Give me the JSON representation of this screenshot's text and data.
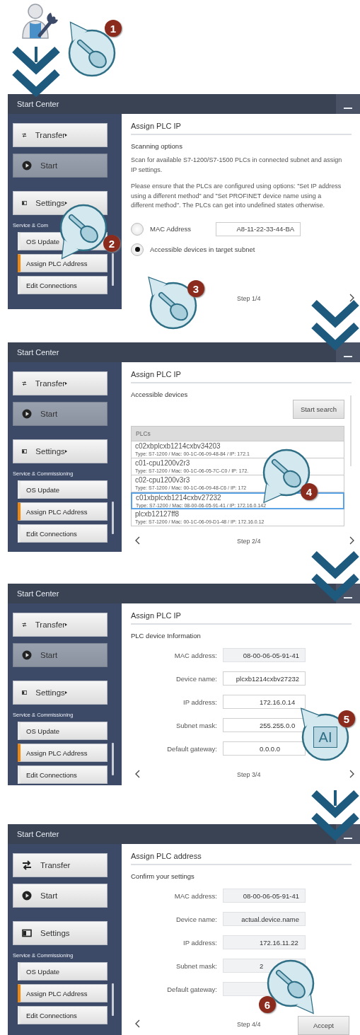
{
  "intro": {
    "callout": {
      "step": "1"
    }
  },
  "screens": [
    {
      "window_title": "Start Center",
      "sidebar": {
        "buttons": [
          {
            "label": "Transfer",
            "submenu": true,
            "disabled": false
          },
          {
            "label": "Start",
            "submenu": false,
            "disabled": true
          },
          {
            "label": "Settings",
            "submenu": true,
            "disabled": false
          }
        ],
        "section": "Service & Com",
        "items": [
          {
            "label": "OS Update",
            "selected": false
          },
          {
            "label": "Assign PLC Address",
            "selected": true
          },
          {
            "label": "Edit Connections",
            "selected": false
          }
        ]
      },
      "content": {
        "kind": "scan",
        "title": "Assign PLC IP",
        "subtitle": "Scanning options",
        "paragraphs": [
          "Scan for available S7-1200/S7-1500 PLCs in connected subnet and assign IP settings.",
          "Please ensure that the PLCs are configured using options: \"Set IP address using a different method\" and \"Set PROFINET device name using a different method\". The PLCs can get into undefined states otherwise."
        ],
        "options": [
          {
            "label": "MAC Address",
            "selected": false,
            "value": "A8-11-22-33-44-BA"
          },
          {
            "label": "Accessible devices in target subnet",
            "selected": true
          }
        ]
      },
      "footer": {
        "back": false,
        "step": "Step 1/4",
        "next": true
      },
      "callouts": [
        {
          "step": "2"
        },
        {
          "step": "3"
        }
      ]
    },
    {
      "window_title": "Start Center",
      "sidebar": {
        "buttons": [
          {
            "label": "Transfer",
            "submenu": true,
            "disabled": false
          },
          {
            "label": "Start",
            "submenu": false,
            "disabled": true
          },
          {
            "label": "Settings",
            "submenu": true,
            "disabled": false
          }
        ],
        "section": "Service & Commissioning",
        "items": [
          {
            "label": "OS Update",
            "selected": false
          },
          {
            "label": "Assign PLC Address",
            "selected": true
          },
          {
            "label": "Edit Connections",
            "selected": false
          }
        ]
      },
      "content": {
        "kind": "list",
        "title": "Assign PLC IP",
        "subtitle": "Accessible devices",
        "search_button": "Start search",
        "table_header": "PLCs",
        "rows": [
          {
            "name": "c02xbplcxb1214cxbv34203",
            "detail": "Type: S7-1200 / Mac: 00-1C-06-09-48-84 / IP: 172.1",
            "selected": false
          },
          {
            "name": "c01-cpu1200v2r3",
            "detail": "Type: S7-1200 / Mac: 00-1C-06-05-7C-C0 / IP: 172.",
            "selected": false
          },
          {
            "name": "c02-cpu1200v3r3",
            "detail": "Type: S7-1200 / Mac: 00-1C-06-09-48-C6 / IP: 172",
            "selected": false
          },
          {
            "name": "c01xbplcxb1214cxbv27232",
            "detail": "Type: S7-1200 / Mac: 08-00-06-05-91-41 / IP: 172.16.0.142",
            "selected": true
          },
          {
            "name": "plcxb12127ff8",
            "detail": "Type: S7-1200 / Mac: 00-1C-06-09-D1-48 / IP: 172.16.0.12",
            "selected": false
          }
        ]
      },
      "footer": {
        "back": true,
        "step": "Step 2/4",
        "next": true
      },
      "callouts": [
        {
          "step": "4"
        }
      ]
    },
    {
      "window_title": "Start Center",
      "sidebar": {
        "buttons": [
          {
            "label": "Transfer",
            "submenu": true,
            "disabled": false
          },
          {
            "label": "Start",
            "submenu": false,
            "disabled": true
          },
          {
            "label": "Settings",
            "submenu": true,
            "disabled": false
          }
        ],
        "section": "Service & Commissioning",
        "items": [
          {
            "label": "OS Update",
            "selected": false
          },
          {
            "label": "Assign PLC Address",
            "selected": true
          },
          {
            "label": "Edit Connections",
            "selected": false
          }
        ]
      },
      "content": {
        "kind": "form",
        "title": "Assign PLC IP",
        "subtitle": "PLC device Information",
        "fields": [
          {
            "label": "MAC address:",
            "value": "08-00-06-05-91-41",
            "readonly": true
          },
          {
            "label": "Device name:",
            "value": "plcxb1214cxbv27232",
            "readonly": false
          },
          {
            "label": "IP address:",
            "value": "172.16.0.14",
            "readonly": false
          },
          {
            "label": "Subnet mask:",
            "value": "255.255.0.0",
            "readonly": false
          },
          {
            "label": "Default gateway:",
            "value": "0.0.0.0",
            "readonly": false
          }
        ]
      },
      "footer": {
        "back": true,
        "step": "Step 3/4",
        "next": true
      },
      "callouts": [
        {
          "step": "5",
          "symbol": "AI"
        }
      ]
    },
    {
      "window_title": "Start Center",
      "sidebar": {
        "buttons": [
          {
            "label": "Transfer",
            "submenu": false,
            "disabled": false
          },
          {
            "label": "Start",
            "submenu": false,
            "disabled": false
          },
          {
            "label": "Settings",
            "submenu": false,
            "disabled": false
          }
        ],
        "section": "Service & Commissioning",
        "items": [
          {
            "label": "OS Update",
            "selected": false
          },
          {
            "label": "Assign PLC Address",
            "selected": true
          },
          {
            "label": "Edit Connections",
            "selected": false
          }
        ]
      },
      "content": {
        "kind": "form",
        "title": "Assign PLC address",
        "subtitle": "Confirm your settings",
        "fields": [
          {
            "label": "MAC address:",
            "value": "08-00-06-05-91-41",
            "readonly": true
          },
          {
            "label": "Device name:",
            "value": "actual.device.name",
            "readonly": true
          },
          {
            "label": "IP address:",
            "value": "172.16.11.22",
            "readonly": true
          },
          {
            "label": "Subnet mask:",
            "value": "2",
            "readonly": true
          },
          {
            "label": "Default gateway:",
            "readonly": true
          }
        ]
      },
      "footer": {
        "back": true,
        "step": "Step 4/4",
        "next": false,
        "accept": "Accept"
      },
      "callouts": [
        {
          "step": "6"
        }
      ]
    }
  ]
}
